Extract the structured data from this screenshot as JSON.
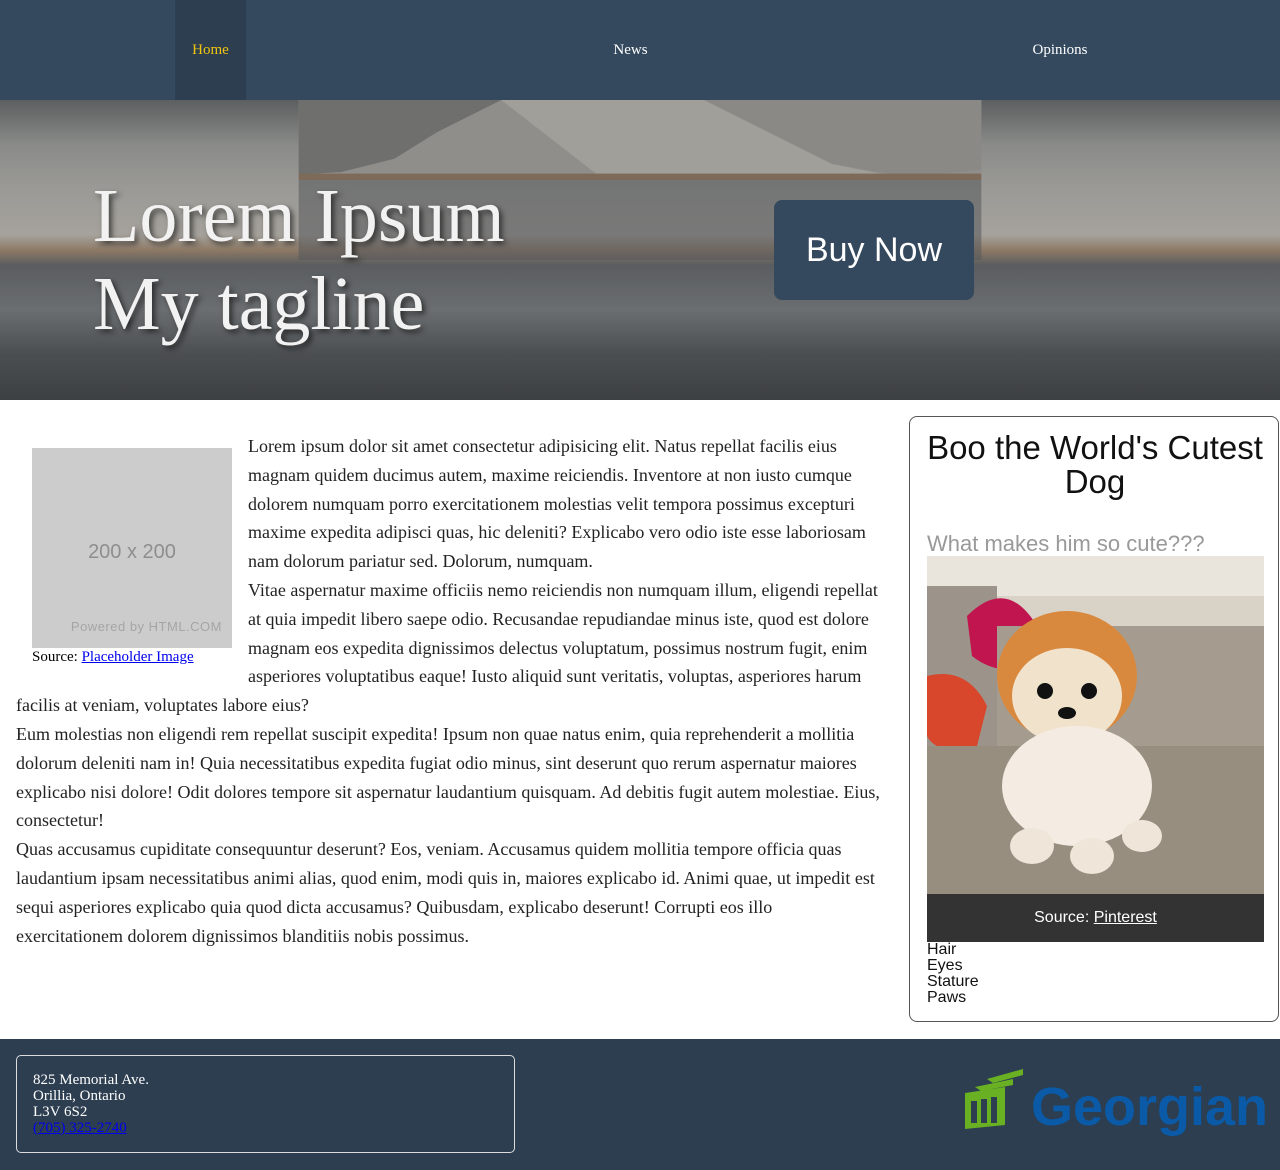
{
  "nav": {
    "items": [
      {
        "label": "Home",
        "active": true
      },
      {
        "label": "News",
        "active": false
      },
      {
        "label": "Opinions",
        "active": false
      }
    ]
  },
  "hero": {
    "title_line1": "Lorem Ipsum",
    "title_line2": "My tagline",
    "button": "Buy Now"
  },
  "main": {
    "placeholder": {
      "size_text": "200 x 200",
      "powered_text": "Powered by HTML.COM",
      "caption_prefix": "Source: ",
      "caption_link": "Placeholder Image"
    },
    "paragraphs": [
      "Lorem ipsum dolor sit amet consectetur adipisicing elit. Natus repellat facilis eius magnam quidem ducimus autem, maxime reiciendis. Inventore at non iusto cumque dolorem numquam porro exercitationem molestias velit tempora possimus excepturi maxime expedita adipisci quas, hic deleniti? Explicabo vero odio iste esse laboriosam nam dolorum pariatur sed. Dolorum, numquam.",
      "Vitae aspernatur maxime officiis nemo reiciendis non numquam illum, eligendi repellat at quia impedit libero saepe odio. Recusandae repudiandae minus iste, quod est dolore magnam eos expedita dignissimos delectus voluptatum, possimus nostrum fugit, enim asperiores voluptatibus eaque! Iusto aliquid sunt veritatis, voluptas, asperiores harum facilis at veniam, voluptates labore eius?",
      "Eum molestias non eligendi rem repellat suscipit expedita! Ipsum non quae natus enim, quia reprehenderit a mollitia dolorum deleniti nam in! Quia necessitatibus expedita fugiat odio minus, sint deserunt quo rerum aspernatur maiores explicabo nisi dolore! Odit dolores tempore sit aspernatur laudantium quisquam. Ad debitis fugit autem molestiae. Eius, consectetur!",
      "Quas accusamus cupiditate consequuntur deserunt? Eos, veniam. Accusamus quidem mollitia tempore officia quas laudantium ipsam necessitatibus animi alias, quod enim, modi quis in, maiores explicabo id. Animi quae, ut impedit est sequi asperiores explicabo quia quod dicta accusamus? Quibusdam, explicabo deserunt! Corrupti eos illo exercitationem dolorem dignissimos blanditiis nobis possimus."
    ]
  },
  "aside": {
    "title": "Boo the World's Cutest Dog",
    "subtitle": "What makes him so cute???",
    "caption_prefix": "Source: ",
    "caption_link": "Pinterest",
    "traits": [
      "Hair",
      "Eyes",
      "Stature",
      "Paws"
    ]
  },
  "footer": {
    "address": [
      "825 Memorial Ave.",
      "Orillia, Ontario",
      "L3V 6S2"
    ],
    "phone": "(705) 325-2740",
    "logo_text": "Georgian"
  },
  "colors": {
    "nav_bg": "#34495e",
    "nav_active_bg": "#2c3e50",
    "nav_active_text": "#f1c40f",
    "footer_bg": "#2c3e50",
    "logo_green": "#6ab023",
    "logo_blue": "#0a5aa8"
  }
}
